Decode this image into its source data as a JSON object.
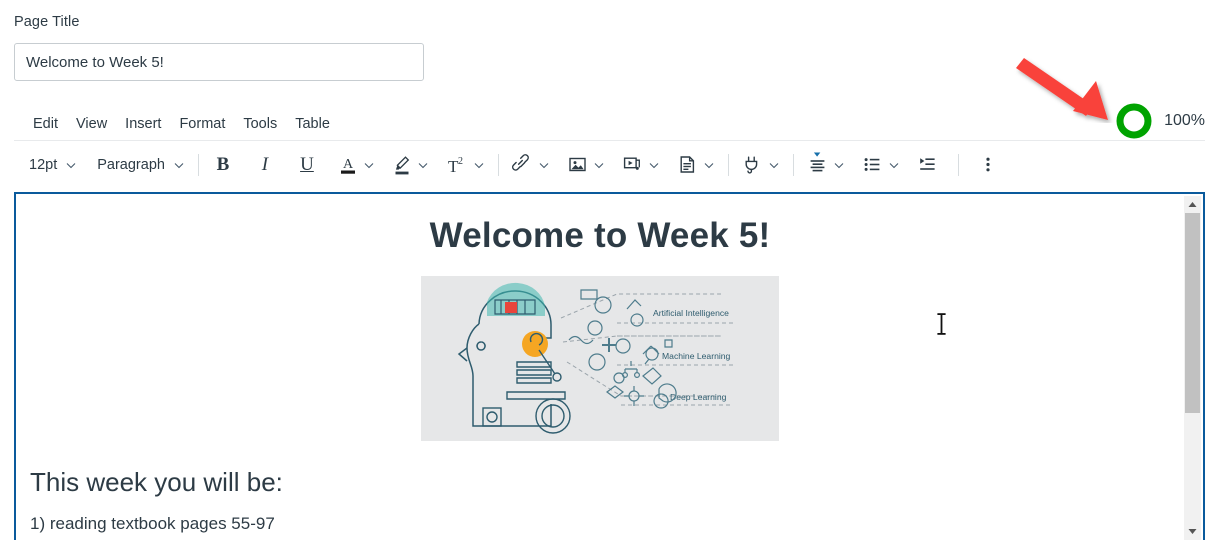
{
  "page": {
    "title_label": "Page Title",
    "title_value": "Welcome to Week 5!",
    "title_placeholder": "Page Title"
  },
  "menubar": {
    "items": [
      {
        "label": "Edit",
        "name": "menu-edit"
      },
      {
        "label": "View",
        "name": "menu-view"
      },
      {
        "label": "Insert",
        "name": "menu-insert"
      },
      {
        "label": "Format",
        "name": "menu-format"
      },
      {
        "label": "Tools",
        "name": "menu-tools"
      },
      {
        "label": "Table",
        "name": "menu-table"
      }
    ]
  },
  "toolbar": {
    "font_size": "12pt",
    "block_format": "Paragraph",
    "bold_label": "B",
    "italic_label": "I",
    "underline_label": "U",
    "superscript_label": "T",
    "superscript_exponent": "2",
    "icons": {
      "text_color": "text-color-icon",
      "highlight": "highlight-color-icon",
      "superscript": "superscript-icon",
      "link": "link-icon",
      "image": "image-icon",
      "media": "media-icon",
      "document": "document-icon",
      "apps": "apps-plug-icon",
      "align": "align-icon",
      "list": "bulleted-list-icon",
      "indent": "indent-icon",
      "more": "more-options-icon"
    }
  },
  "status": {
    "percent_label": "100%",
    "progress_value": 100,
    "accent_green": "#00A300",
    "arrow_color": "#F9423A",
    "focus_blue": "#0A5A9C"
  },
  "document": {
    "heading": "Welcome to Week 5!",
    "image_alt": "Artificial Intelligence infographic",
    "image_labels": [
      "Artificial Intelligence",
      "Machine Learning",
      "Deep Learning"
    ],
    "subheading": "This week you will be:",
    "list_line_1": "1) reading textbook pages 55-97"
  },
  "scrollbar": {
    "up_arrow": "scroll-up-arrow",
    "down_arrow": "scroll-down-arrow",
    "thumb_position_pct": 0
  }
}
